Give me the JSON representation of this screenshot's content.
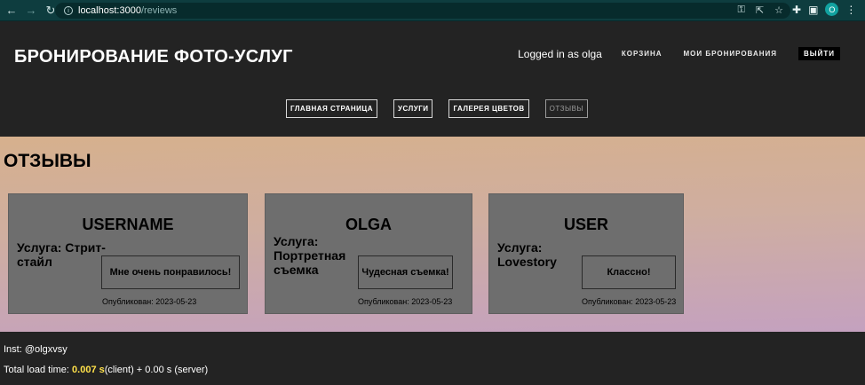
{
  "browser": {
    "url_host": "localhost:3000",
    "url_path": "/reviews",
    "profile_initial": "O"
  },
  "header": {
    "site_title": "БРОНИРОВАНИЕ ФОТО-УСЛУГ",
    "logged_in_text": "Logged in as olga",
    "cart_label": "КОРЗИНА",
    "bookings_label": "МОИ БРОНИРОВАНИЯ",
    "logout_label": "ВЫЙТИ"
  },
  "main_nav": [
    {
      "label": "ГЛАВНАЯ СТРАНИЦА"
    },
    {
      "label": "УСЛУГИ"
    },
    {
      "label": "ГАЛЕРЕЯ ЦВЕТОВ"
    },
    {
      "label": "ОТЗЫВЫ",
      "active": true
    }
  ],
  "page": {
    "heading": "ОТЗЫВЫ"
  },
  "reviews": [
    {
      "username": "USERNAME",
      "service": "Услуга: Стрит-стайл",
      "text": "Мне очень понравилось!",
      "date": "Опубликован: 2023-05-23"
    },
    {
      "username": "OLGA",
      "service": "Услуга: Портретная съемка",
      "text": "Чудесная съемка!",
      "date": "Опубликован: 2023-05-23"
    },
    {
      "username": "USER",
      "service": "Услуга: Lovestory",
      "text": "Классно!",
      "date": "Опубликован: 2023-05-23"
    }
  ],
  "footer": {
    "inst": "Inst: @olgxvsy",
    "load_prefix": "Total load time: ",
    "load_client_value": "0.007 s",
    "load_suffix": "(client) + 0.00 s (server)"
  },
  "colors": {
    "header_bg": "#232323",
    "card_bg": "#6e6e6e",
    "highlight": "#ffe14a"
  }
}
